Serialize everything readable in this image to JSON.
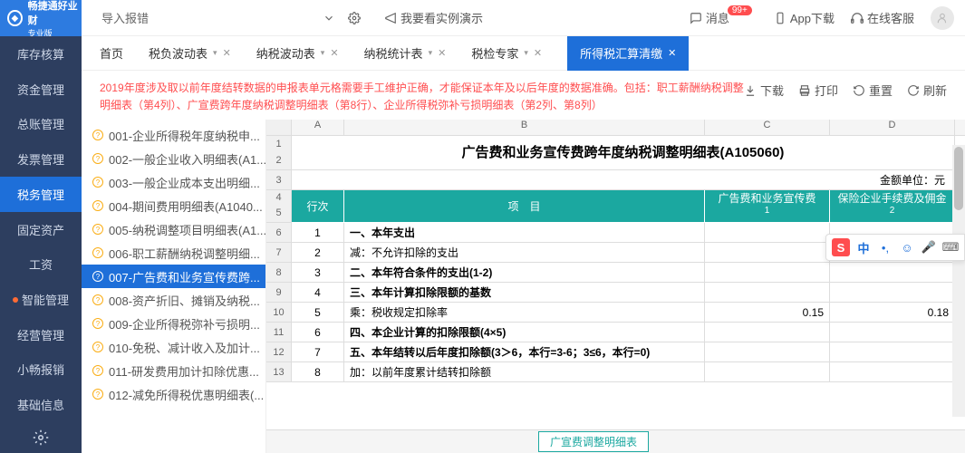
{
  "brand": {
    "name": "畅捷通好业财",
    "edition": "专业版"
  },
  "top": {
    "search": "导入报错",
    "demo": "我要看实例演示",
    "msg": "消息",
    "msg_badge": "99+",
    "app": "App下载",
    "service": "在线客服"
  },
  "sidebar": [
    "库存核算",
    "资金管理",
    "总账管理",
    "发票管理",
    "税务管理",
    "固定资产",
    "工资",
    "智能管理",
    "经营管理",
    "小畅报销",
    "基础信息"
  ],
  "sidebar_active": 4,
  "sidebar_dotted": 7,
  "tabs": [
    {
      "label": "首页",
      "close": false
    },
    {
      "label": "税负波动表",
      "close": true,
      "caret": true
    },
    {
      "label": "纳税波动表",
      "close": true,
      "caret": true
    },
    {
      "label": "纳税统计表",
      "close": true,
      "caret": true
    },
    {
      "label": "税检专家",
      "close": true,
      "caret": true
    },
    {
      "label": "所得税汇算清缴",
      "close": true,
      "active": true
    }
  ],
  "notice": "2019年度涉及取以前年度结转数据的申报表单元格需要手工维护正确，才能保证本年及以后年度的数据准确。包括：职工薪酬纳税调整明细表（第4列）、广宣费跨年度纳税调整明细表（第8行）、企业所得税弥补亏损明细表（第2列、第8列）",
  "toolbar": {
    "download": "下载",
    "print": "打印",
    "reset": "重置",
    "refresh": "刷新"
  },
  "tree": [
    "001-企业所得税年度纳税申...",
    "002-一般企业收入明细表(A1...",
    "003-一般企业成本支出明细...",
    "004-期间费用明细表(A1040...",
    "005-纳税调整项目明细表(A1...",
    "006-职工薪酬纳税调整明细...",
    "007-广告费和业务宣传费跨...",
    "008-资产折旧、摊销及纳税...",
    "009-企业所得税弥补亏损明...",
    "010-免税、减计收入及加计...",
    "011-研发费用加计扣除优惠...",
    "012-减免所得税优惠明细表(..."
  ],
  "tree_sel": 6,
  "sheet": {
    "title": "广告费和业务宣传费跨年度纳税调整明细表(A105060)",
    "unit": "金额单位：元",
    "cols": [
      "A",
      "B",
      "C",
      "D"
    ],
    "hdr": {
      "a": "行次",
      "b": "项　目",
      "c": "广告费和业务宣传费",
      "d": "保险企业手续费及佣金",
      "c2": "1",
      "d2": "2"
    },
    "rows": [
      {
        "n": 1,
        "b": "一、本年支出",
        "bold": true
      },
      {
        "n": 2,
        "b": "减：不允许扣除的支出"
      },
      {
        "n": 3,
        "b": "二、本年符合条件的支出(1-2)",
        "bold": true
      },
      {
        "n": 4,
        "b": "三、本年计算扣除限额的基数",
        "bold": true
      },
      {
        "n": 5,
        "b": "乘：税收规定扣除率",
        "c": "0.15",
        "d": "0.18"
      },
      {
        "n": 6,
        "b": "四、本企业计算的扣除限额(4×5)",
        "bold": true
      },
      {
        "n": 7,
        "b": "五、本年结转以后年度扣除额(3＞6，本行=3-6；3≤6，本行=0)",
        "bold": true
      },
      {
        "n": 8,
        "b": "加：以前年度累计结转扣除额"
      }
    ],
    "tab": "广宣费调整明细表"
  },
  "float": {
    "cn": "中"
  }
}
